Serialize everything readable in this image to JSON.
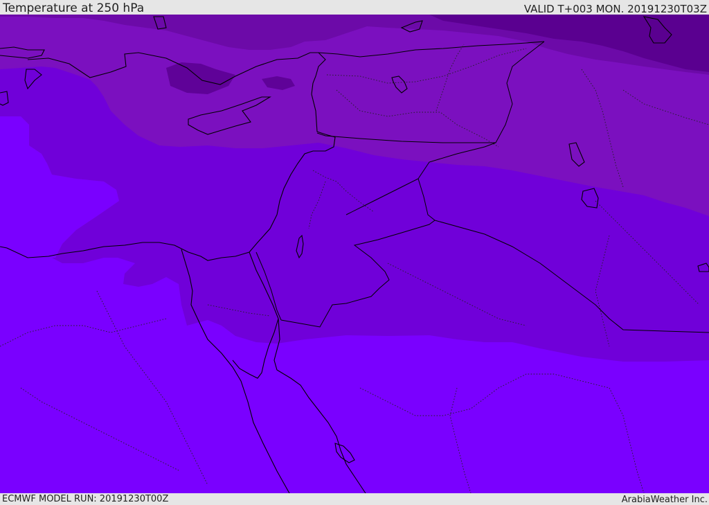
{
  "header": {
    "title": "Temperature at 250 hPa",
    "valid": "VALID T+003 MON. 20191230T03Z"
  },
  "footer": {
    "model_run": "ECMWF MODEL RUN: 20191230T00Z",
    "credit": "ArabiaWeather Inc."
  },
  "map": {
    "colors": {
      "coldest": "#5a0090",
      "colder": "#6c0aa8",
      "cold": "#7b10bf",
      "mid": "#7000d9",
      "warm": "#7a00ff",
      "coastline": "#000000",
      "border": "#222222"
    }
  }
}
